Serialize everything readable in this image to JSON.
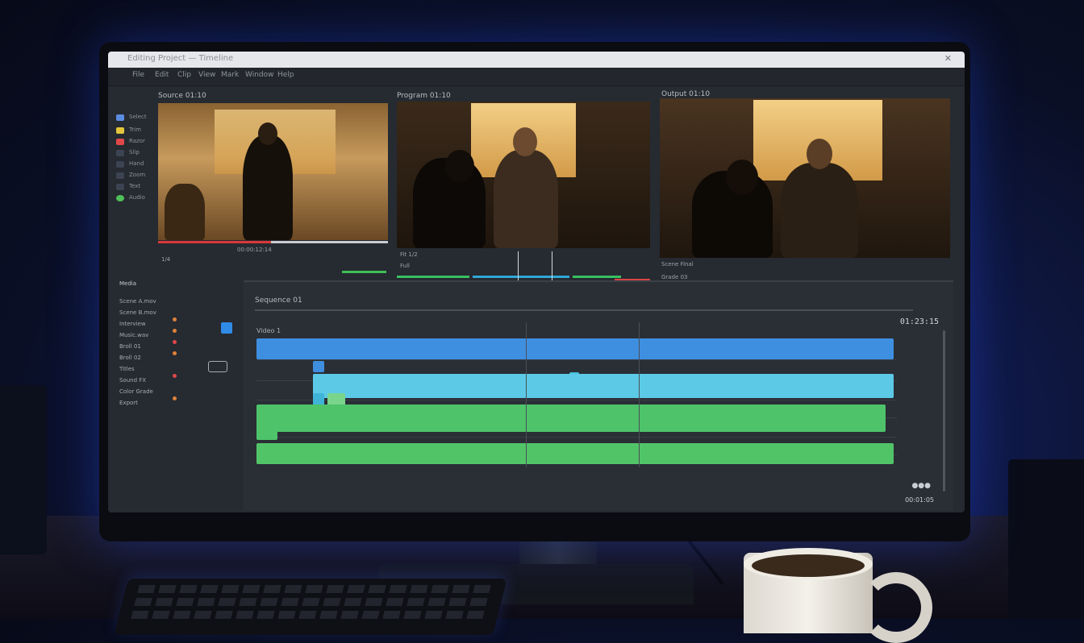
{
  "window": {
    "title": "Editing Project — Timeline",
    "close": "✕"
  },
  "menu": [
    "File",
    "Edit",
    "Clip",
    "View",
    "Mark",
    "Window",
    "Help"
  ],
  "tools": [
    {
      "label": "Select",
      "color": "#5a8de0"
    },
    {
      "label": "Trim",
      "color": "#e3c53c"
    },
    {
      "label": "Razor",
      "color": "#e04848"
    },
    {
      "label": "Slip",
      "color": "#3c4452"
    },
    {
      "label": "Hand",
      "color": "#3c4452"
    },
    {
      "label": "Zoom",
      "color": "#3c4452"
    },
    {
      "label": "Text",
      "color": "#3c4452"
    },
    {
      "label": "Audio",
      "color": "#4fbf5a"
    }
  ],
  "viewers": {
    "source": {
      "title": "Source 01:10",
      "timecode": "00:00:12:14",
      "sub": "1/4"
    },
    "program": {
      "title": "Program 01:10",
      "timecode": "Fit  1/2",
      "sub": "Full"
    },
    "output": {
      "title": "Output 01:10",
      "label_a": "Scene Final",
      "label_b": "Grade 03"
    }
  },
  "browser": {
    "header": "Media",
    "items": [
      "Scene A.mov",
      "Scene B.mov",
      "Interview",
      "Music.wav",
      "Broll 01",
      "Broll 02",
      "Titles",
      "Sound FX",
      "Color Grade",
      "Export"
    ]
  },
  "timeline": {
    "title": "Sequence 01",
    "track_label": "Video 1",
    "timecode": "01:23:15",
    "footer": "00:01:05"
  }
}
